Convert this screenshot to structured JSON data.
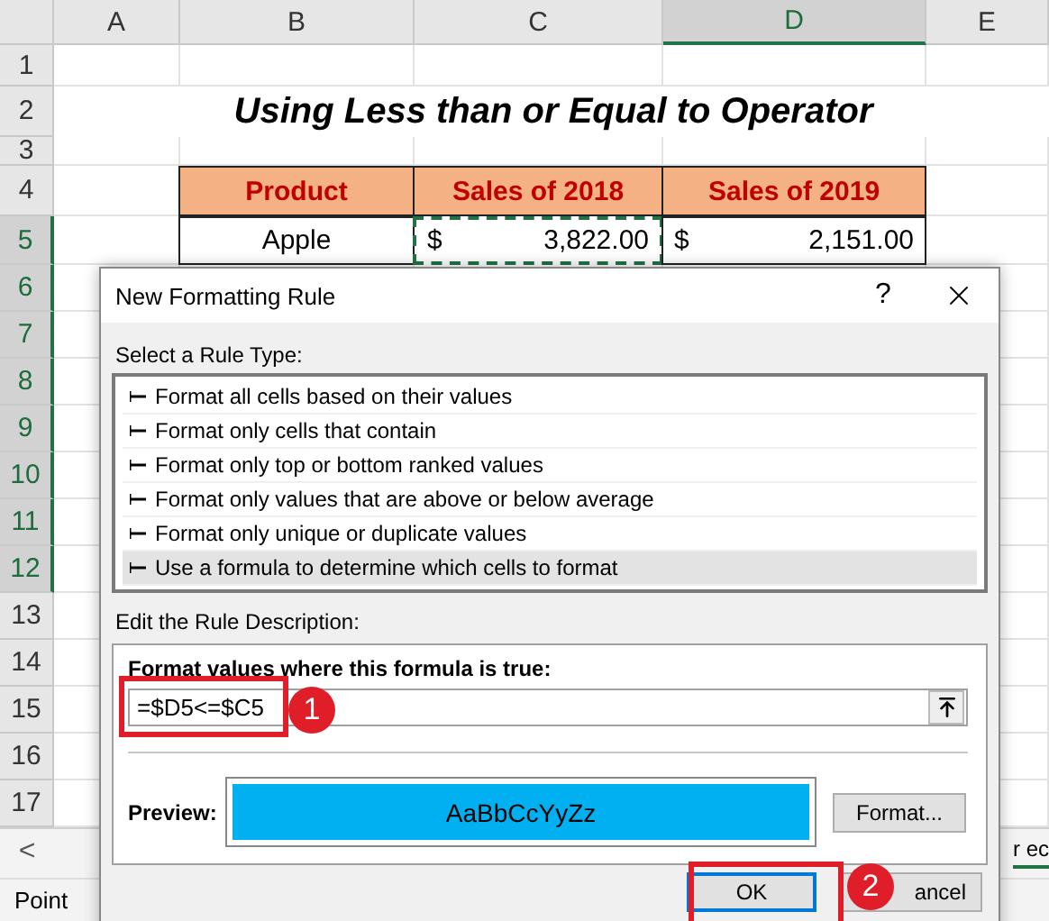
{
  "sheet": {
    "columns": [
      {
        "label": "A",
        "selected": false
      },
      {
        "label": "B",
        "selected": false
      },
      {
        "label": "C",
        "selected": false
      },
      {
        "label": "D",
        "selected": true
      },
      {
        "label": "E",
        "selected": false
      }
    ],
    "rows": [
      {
        "label": "1",
        "selected": false
      },
      {
        "label": "2",
        "selected": false
      },
      {
        "label": "3",
        "selected": false
      },
      {
        "label": "4",
        "selected": false
      },
      {
        "label": "5",
        "selected": true
      },
      {
        "label": "6",
        "selected": true
      },
      {
        "label": "7",
        "selected": true
      },
      {
        "label": "8",
        "selected": true
      },
      {
        "label": "9",
        "selected": true
      },
      {
        "label": "10",
        "selected": true
      },
      {
        "label": "11",
        "selected": true
      },
      {
        "label": "12",
        "selected": true
      },
      {
        "label": "13",
        "selected": false
      },
      {
        "label": "14",
        "selected": false
      },
      {
        "label": "15",
        "selected": false
      },
      {
        "label": "16",
        "selected": false
      },
      {
        "label": "17",
        "selected": false
      }
    ],
    "title": "Using Less than or Equal to Operator",
    "table_headers": [
      "Product",
      "Sales of 2018",
      "Sales of 2019"
    ],
    "table_row": [
      {
        "kind": "text",
        "value": "Apple"
      },
      {
        "kind": "money",
        "currency": "$",
        "amount": "3,822.00",
        "marquee": true
      },
      {
        "kind": "money",
        "currency": "$",
        "amount": "2,151.00",
        "marquee": false
      }
    ]
  },
  "sheet_tabs": {
    "nav": "<",
    "partial_tab": "r ec"
  },
  "status_bar": "Point",
  "dialog": {
    "title": "New Formatting Rule",
    "help": "?",
    "rule_type_label": "Select a Rule Type:",
    "rule_types": [
      {
        "label": "Format all cells based on their values",
        "selected": false
      },
      {
        "label": "Format only cells that contain",
        "selected": false
      },
      {
        "label": "Format only top or bottom ranked values",
        "selected": false
      },
      {
        "label": "Format only values that are above or below average",
        "selected": false
      },
      {
        "label": "Format only unique or duplicate values",
        "selected": false
      },
      {
        "label": "Use a formula to determine which cells to format",
        "selected": true
      }
    ],
    "description_label": "Edit the Rule Description:",
    "formula_label": "Format values where this formula is true:",
    "formula": "=$D5<=$C5",
    "preview_label": "Preview:",
    "preview_text": "AaBbCcYyZz",
    "format_button": "Format...",
    "ok_button": "OK",
    "cancel_button": "ancel"
  },
  "callouts": [
    "1",
    "2"
  ]
}
